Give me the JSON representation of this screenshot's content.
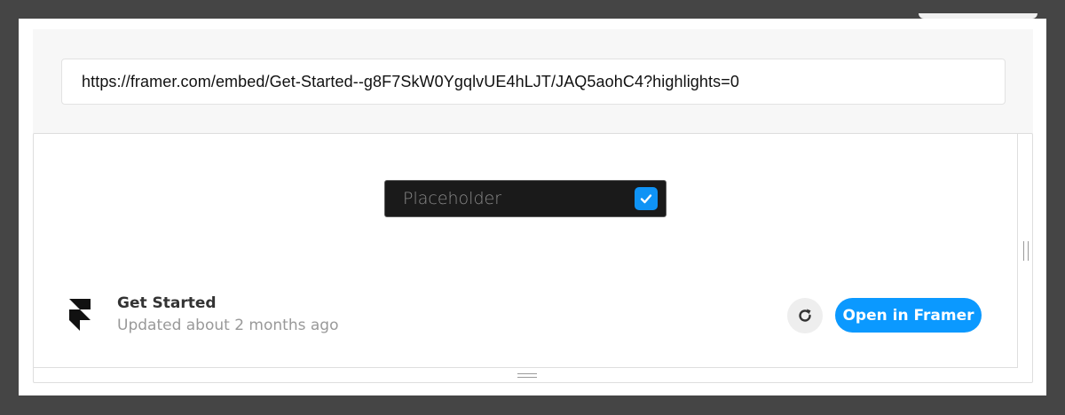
{
  "url_field": {
    "value": "https://framer.com/embed/Get-Started--g8F7SkW0YgqlvUE4hLJT/JAQ5aohC4?highlights=0"
  },
  "embed": {
    "input": {
      "placeholder": "Placeholder",
      "checked": true
    },
    "project": {
      "title": "Get Started",
      "updated": "Updated about 2 months ago",
      "logo_icon": "framer-logo-icon"
    },
    "actions": {
      "refresh_icon": "refresh-icon",
      "open_label": "Open in Framer"
    }
  },
  "colors": {
    "accent": "#0b99ff",
    "checkbox": "#0f93f5",
    "input_bg": "#1a1a1a"
  }
}
